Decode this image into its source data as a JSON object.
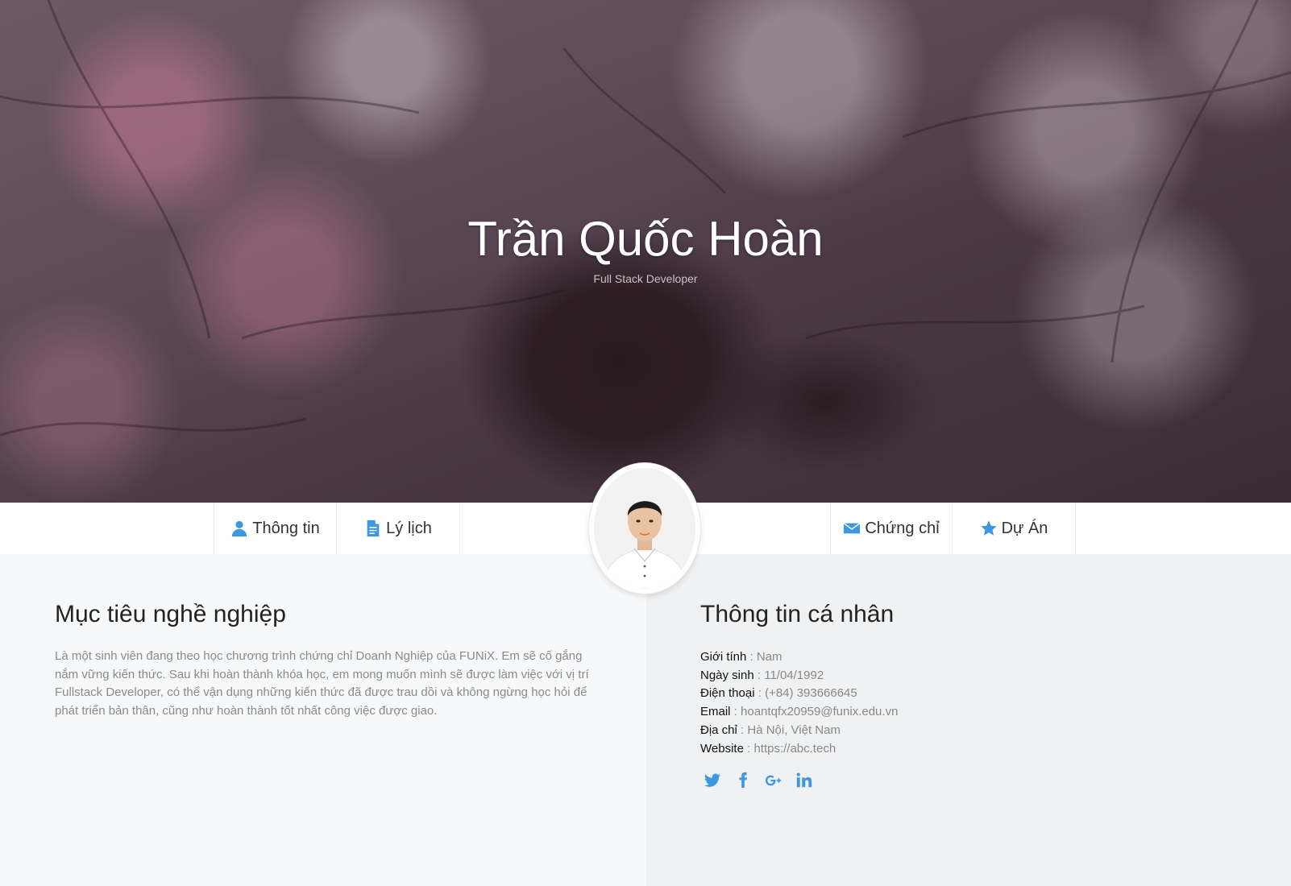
{
  "hero": {
    "name": "Trần Quốc Hoàn",
    "role": "Full Stack Developer"
  },
  "nav": {
    "items": [
      {
        "label": "Thông tin",
        "icon": "user-icon"
      },
      {
        "label": "Lý lịch",
        "icon": "document-icon"
      },
      {
        "label": "Chứng chỉ",
        "icon": "envelope-icon"
      },
      {
        "label": "Dự Án",
        "icon": "star-icon"
      }
    ]
  },
  "objective": {
    "title": "Mục tiêu nghề nghiệp",
    "text": "Là một sinh viên đang theo học chương trình chứng chỉ Doanh Nghiệp của FUNiX. Em sẽ cố gắng nắm vững kiến thức. Sau khi hoàn thành khóa học, em mong muốn mình sẽ được làm việc với vị trí Fullstack Developer, có thể vận dụng những kiến thức đã được trau dồi và không ngừng học hỏi để phát triển bản thân, cũng như hoàn thành tốt nhất công việc được giao."
  },
  "personal": {
    "title": "Thông tin cá nhân",
    "rows": [
      {
        "label": "Giới tính",
        "sep": " : ",
        "value": "Nam"
      },
      {
        "label": "Ngày sinh",
        "sep": " : ",
        "value": "11/04/1992"
      },
      {
        "label": "Điện thoại",
        "sep": " : ",
        "value": "(+84) 393666645"
      },
      {
        "label": "Email",
        "sep": " : ",
        "value": "hoantqfx20959@funix.edu.vn"
      },
      {
        "label": "Địa chỉ",
        "sep": " : ",
        "value": "Hà Nội, Việt Nam"
      },
      {
        "label": "Website",
        "sep": " : ",
        "value": "https://abc.tech"
      }
    ],
    "socials": [
      "twitter-icon",
      "facebook-icon",
      "google-plus-icon",
      "linkedin-icon"
    ]
  },
  "colors": {
    "accent": "#3d97e3",
    "heading": "#222222",
    "muted_text": "#8a8a8a"
  }
}
